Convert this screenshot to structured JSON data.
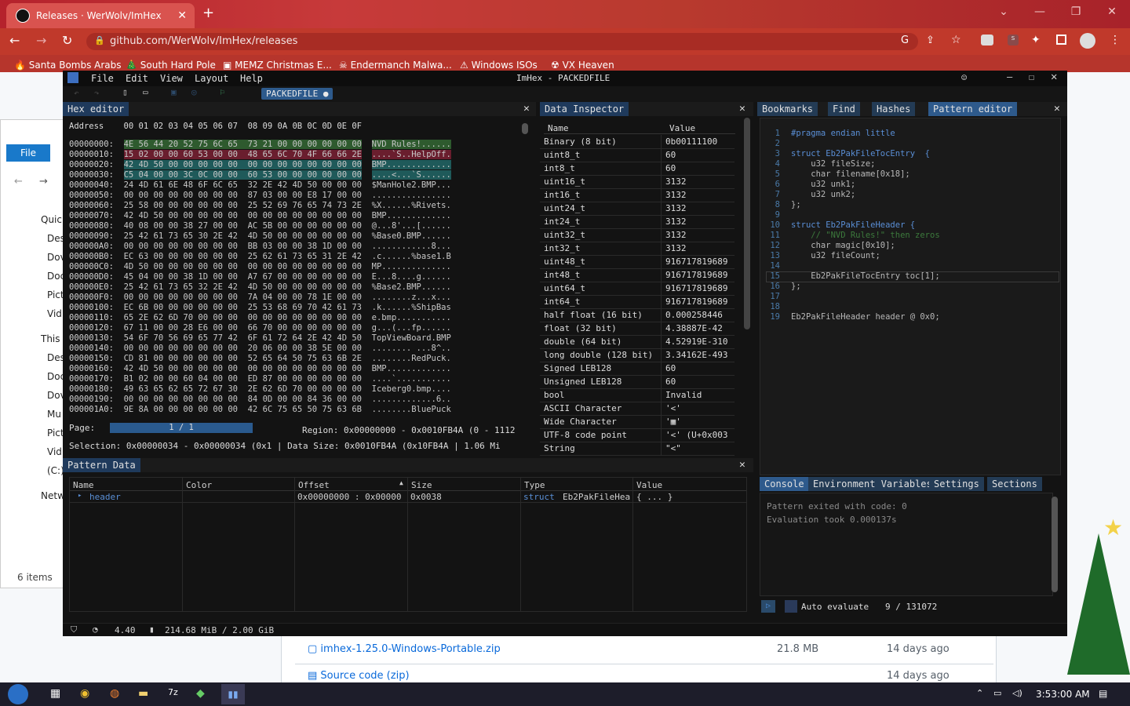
{
  "browser": {
    "tab_title": "Releases · WerWolv/ImHex",
    "url": "github.com/WerWolv/ImHex/releases",
    "bookmarks": [
      "Santa Bombs Arabs",
      "South Hard Pole",
      "MEMZ Christmas E...",
      "Endermanch Malwa...",
      "Windows ISOs",
      "VX Heaven"
    ]
  },
  "page": {
    "assets": [
      {
        "name": "imhex-1.25.0-Windows-Portable.zip",
        "size": "21.8 MB",
        "date": "14 days ago"
      },
      {
        "name": "Source code (zip)",
        "size": "",
        "date": "14 days ago"
      }
    ]
  },
  "explorer": {
    "file_tab": "File",
    "items": [
      "Quicl",
      "Des",
      "Dov",
      "Doc",
      "Pict",
      "Vid",
      "This P",
      "Des",
      "Doc",
      "Dov",
      "Mu",
      "Pict",
      "Vid",
      "(C:)",
      "Netw"
    ],
    "count": "6 items"
  },
  "imhex": {
    "title": "ImHex - PACKEDFILE",
    "menu": [
      "File",
      "Edit",
      "View",
      "Layout",
      "Help"
    ],
    "provider_tab": "PACKEDFILE",
    "hex_editor": {
      "title": "Hex editor",
      "header": "Address    00 01 02 03 04 05 06 07  08 09 0A 0B 0C 0D 0E 0F",
      "rows": [
        {
          "addr": "00000000:",
          "bytes": "4E 56 44 20 52 75 6C 65  73 21 00 00 00 00 00 00",
          "ascii": "NVD Rules!......"
        },
        {
          "addr": "00000010:",
          "bytes": "15 02 00 00 60 53 00 00  48 65 6C 70 4F 66 66 2E",
          "ascii": "....`S..HelpOff."
        },
        {
          "addr": "00000020:",
          "bytes": "42 4D 50 00 00 00 00 00  00 00 00 00 00 00 00 00",
          "ascii": "BMP............."
        },
        {
          "addr": "00000030:",
          "bytes": "C5 04 00 00 3C 0C 00 00  60 53 00 00 00 00 00 00",
          "ascii": "....<...`S......"
        },
        {
          "addr": "00000040:",
          "bytes": "24 4D 61 6E 48 6F 6C 65  32 2E 42 4D 50 00 00 00",
          "ascii": "$ManHole2.BMP..."
        },
        {
          "addr": "00000050:",
          "bytes": "00 00 00 00 00 00 00 00  87 03 00 00 E8 17 00 00",
          "ascii": "................"
        },
        {
          "addr": "00000060:",
          "bytes": "25 58 00 00 00 00 00 00  25 52 69 76 65 74 73 2E",
          "ascii": "%X......%Rivets."
        },
        {
          "addr": "00000070:",
          "bytes": "42 4D 50 00 00 00 00 00  00 00 00 00 00 00 00 00",
          "ascii": "BMP............."
        },
        {
          "addr": "00000080:",
          "bytes": "40 08 00 00 38 27 00 00  AC 5B 00 00 00 00 00 00",
          "ascii": "@...8'...[......"
        },
        {
          "addr": "00000090:",
          "bytes": "25 42 61 73 65 30 2E 42  4D 50 00 00 00 00 00 00",
          "ascii": "%Base0.BMP......"
        },
        {
          "addr": "000000A0:",
          "bytes": "00 00 00 00 00 00 00 00  BB 03 00 00 38 1D 00 00",
          "ascii": "............8..."
        },
        {
          "addr": "000000B0:",
          "bytes": "EC 63 00 00 00 00 00 00  25 62 61 73 65 31 2E 42",
          "ascii": ".c......%base1.B"
        },
        {
          "addr": "000000C0:",
          "bytes": "4D 50 00 00 00 00 00 00  00 00 00 00 00 00 00 00",
          "ascii": "MP.............."
        },
        {
          "addr": "000000D0:",
          "bytes": "45 04 00 00 38 1D 00 00  A7 67 00 00 00 00 00 00",
          "ascii": "E...8....g......"
        },
        {
          "addr": "000000E0:",
          "bytes": "25 42 61 73 65 32 2E 42  4D 50 00 00 00 00 00 00",
          "ascii": "%Base2.BMP......"
        },
        {
          "addr": "000000F0:",
          "bytes": "00 00 00 00 00 00 00 00  7A 04 00 00 78 1E 00 00",
          "ascii": "........z...x..."
        },
        {
          "addr": "00000100:",
          "bytes": "EC 6B 00 00 00 00 00 00  25 53 68 69 70 42 61 73",
          "ascii": ".k......%ShipBas"
        },
        {
          "addr": "00000110:",
          "bytes": "65 2E 62 6D 70 00 00 00  00 00 00 00 00 00 00 00",
          "ascii": "e.bmp..........."
        },
        {
          "addr": "00000120:",
          "bytes": "67 11 00 00 28 E6 00 00  66 70 00 00 00 00 00 00",
          "ascii": "g...(...fp......"
        },
        {
          "addr": "00000130:",
          "bytes": "54 6F 70 56 69 65 77 42  6F 61 72 64 2E 42 4D 50",
          "ascii": "TopViewBoard.BMP"
        },
        {
          "addr": "00000140:",
          "bytes": "00 00 00 00 00 00 00 00  20 06 00 00 38 5E 00 00",
          "ascii": "........ ...8^.."
        },
        {
          "addr": "00000150:",
          "bytes": "CD 81 00 00 00 00 00 00  52 65 64 50 75 63 6B 2E",
          "ascii": "........RedPuck."
        },
        {
          "addr": "00000160:",
          "bytes": "42 4D 50 00 00 00 00 00  00 00 00 00 00 00 00 00",
          "ascii": "BMP............."
        },
        {
          "addr": "00000170:",
          "bytes": "B1 02 00 00 60 04 00 00  ED 87 00 00 00 00 00 00",
          "ascii": "....`..........."
        },
        {
          "addr": "00000180:",
          "bytes": "49 63 65 62 65 72 67 30  2E 62 6D 70 00 00 00 00",
          "ascii": "Iceberg0.bmp...."
        },
        {
          "addr": "00000190:",
          "bytes": "00 00 00 00 00 00 00 00  84 0D 00 00 84 36 00 00",
          "ascii": ".............6.."
        },
        {
          "addr": "000001A0:",
          "bytes": "9E 8A 00 00 00 00 00 00  42 6C 75 65 50 75 63 6B",
          "ascii": "........BluePuck"
        }
      ],
      "page_label": "Page:",
      "page_value": "1 / 1",
      "region": "Region: 0x00000000 - 0x0010FB4A (0 - 1112",
      "selection": "Selection: 0x00000034 - 0x00000034 (0x1 | Data Size: 0x0010FB4A (0x10FB4A | 1.06 Mi"
    },
    "inspector": {
      "title": "Data Inspector",
      "col_name": "Name",
      "col_value": "Value",
      "rows": [
        {
          "name": "Binary (8 bit)",
          "value": "0b00111100"
        },
        {
          "name": "uint8_t",
          "value": "60"
        },
        {
          "name": "int8_t",
          "value": "60"
        },
        {
          "name": "uint16_t",
          "value": "3132"
        },
        {
          "name": "int16_t",
          "value": "3132"
        },
        {
          "name": "uint24_t",
          "value": "3132"
        },
        {
          "name": "int24_t",
          "value": "3132"
        },
        {
          "name": "uint32_t",
          "value": "3132"
        },
        {
          "name": "int32_t",
          "value": "3132"
        },
        {
          "name": "uint48_t",
          "value": "916717819689"
        },
        {
          "name": "int48_t",
          "value": "916717819689"
        },
        {
          "name": "uint64_t",
          "value": "916717819689"
        },
        {
          "name": "int64_t",
          "value": "916717819689"
        },
        {
          "name": "half float (16 bit)",
          "value": "0.000258446"
        },
        {
          "name": "float (32 bit)",
          "value": "4.38887E-42"
        },
        {
          "name": "double (64 bit)",
          "value": "4.52919E-310"
        },
        {
          "name": "long double (128 bit)",
          "value": "3.34162E-493"
        },
        {
          "name": "Signed LEB128",
          "value": "60"
        },
        {
          "name": "Unsigned LEB128",
          "value": "60"
        },
        {
          "name": "bool",
          "value": "Invalid"
        },
        {
          "name": "ASCII Character",
          "value": "'<'"
        },
        {
          "name": "Wide Character",
          "value": "'▦'"
        },
        {
          "name": "UTF-8 code point",
          "value": "'<' (U+0x003"
        },
        {
          "name": "String",
          "value": "\"<\""
        }
      ]
    },
    "right_tabs": [
      "Bookmarks",
      "Find",
      "Hashes",
      "Pattern editor"
    ],
    "pattern_code": [
      {
        "n": "1",
        "text": "#pragma endian little"
      },
      {
        "n": "2",
        "text": ""
      },
      {
        "n": "3",
        "text": "struct Eb2PakFileTocEntry  {"
      },
      {
        "n": "4",
        "text": "    u32 fileSize;"
      },
      {
        "n": "5",
        "text": "    char filename[0x18];"
      },
      {
        "n": "6",
        "text": "    u32 unk1;"
      },
      {
        "n": "7",
        "text": "    u32 unk2;"
      },
      {
        "n": "8",
        "text": "};"
      },
      {
        "n": "9",
        "text": ""
      },
      {
        "n": "10",
        "text": "struct Eb2PakFileHeader {"
      },
      {
        "n": "11",
        "text": "    // \"NVD Rules!\" then zeros"
      },
      {
        "n": "12",
        "text": "    char magic[0x10];"
      },
      {
        "n": "13",
        "text": "    u32 fileCount;"
      },
      {
        "n": "14",
        "text": ""
      },
      {
        "n": "15",
        "text": "    Eb2PakFileTocEntry toc[1];"
      },
      {
        "n": "16",
        "text": "};"
      },
      {
        "n": "17",
        "text": ""
      },
      {
        "n": "18",
        "text": ""
      },
      {
        "n": "19",
        "text": "Eb2PakFileHeader header @ 0x0;"
      }
    ],
    "pattern_data": {
      "title": "Pattern Data",
      "columns": [
        "Name",
        "Color",
        "Offset",
        "Size",
        "Type",
        "Value"
      ],
      "row": {
        "name": "header",
        "offset": "0x00000000 : 0x00000",
        "size": "0x0038",
        "type_kw": "struct",
        "type": "Eb2PakFileHea",
        "value": "{ ... }"
      }
    },
    "console_tabs": [
      "Console",
      "Environment Variables",
      "Settings",
      "Sections"
    ],
    "console_lines": [
      "Pattern exited with code: 0",
      "Evaluation took 0.000137s"
    ],
    "auto_evaluate": "Auto evaluate",
    "eval_counter": "9 / 131072",
    "status": {
      "fps": "4.40",
      "memory": "214.68 MiB / 2.00 GiB"
    }
  },
  "taskbar": {
    "clock": "3:53:00 AM"
  }
}
